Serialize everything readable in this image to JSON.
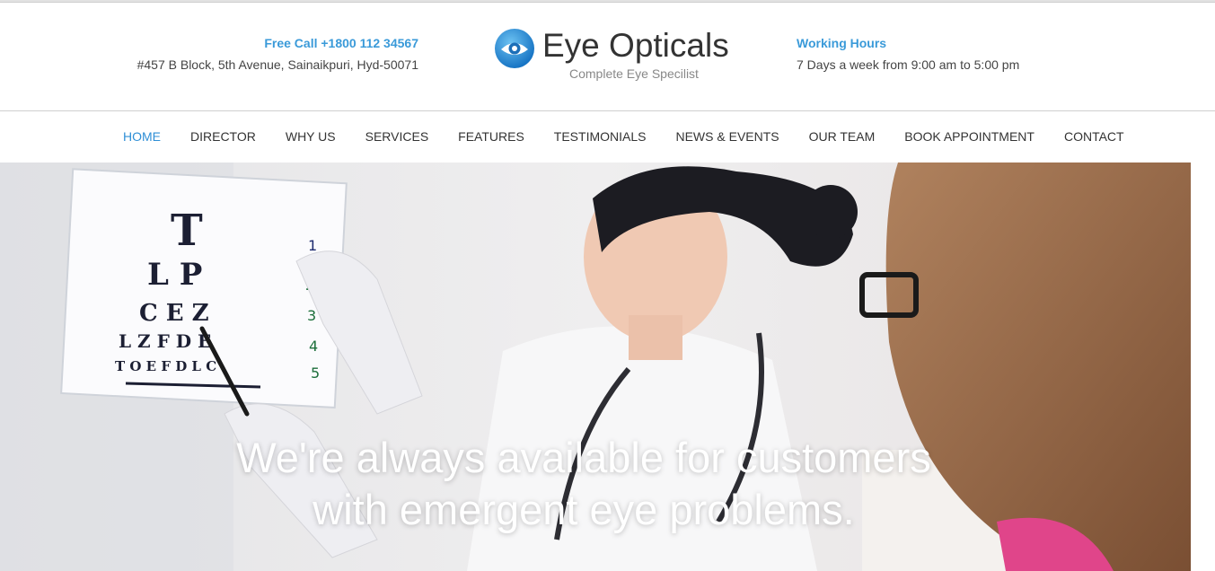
{
  "header": {
    "call_label": "Free Call +1800 112 34567",
    "address": "#457 B Block, 5th Avenue, Sainaikpuri, Hyd-50071",
    "brand_name": "Eye Opticals",
    "tagline": "Complete Eye Specilist",
    "hours_label": "Working Hours",
    "hours_value": "7 Days a week from 9:00 am to 5:00 pm",
    "accent_color": "#3a9ad9"
  },
  "nav": {
    "items": [
      {
        "label": "HOME",
        "active": true
      },
      {
        "label": "DIRECTOR"
      },
      {
        "label": "WHY US"
      },
      {
        "label": "SERVICES"
      },
      {
        "label": "FEATURES"
      },
      {
        "label": "TESTIMONIALS"
      },
      {
        "label": "NEWS & EVENTS"
      },
      {
        "label": "OUR TEAM"
      },
      {
        "label": "BOOK APPOINTMENT"
      },
      {
        "label": "CONTACT"
      }
    ]
  },
  "hero": {
    "line1": "We're always available for customers",
    "line2": "with emergent eye problems.",
    "chart_letters": {
      "row1": "T",
      "row2": "L P",
      "row3": "C E Z",
      "row4": "L Z F D E",
      "row5": "T O E F D L C",
      "numbers": [
        "1",
        "2",
        "3",
        "4",
        "5"
      ]
    }
  }
}
